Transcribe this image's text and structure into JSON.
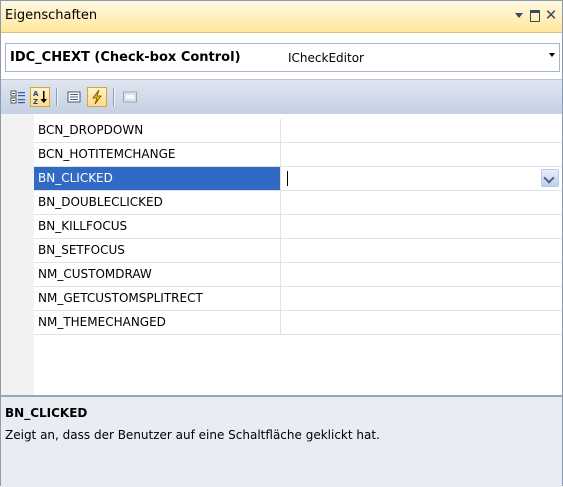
{
  "panel": {
    "title": "Eigenschaften",
    "buttons": {
      "dropdown": "window-position-icon",
      "float": "float-icon",
      "close": "close-icon"
    }
  },
  "selector": {
    "object_name": "IDC_CHEXT (Check-box Control)",
    "object_type": "ICheckEditor"
  },
  "toolbar": {
    "buttons": [
      {
        "name": "categorized-icon",
        "active": false
      },
      {
        "name": "alphabetical-icon",
        "active": true
      },
      {
        "name": "properties-icon",
        "active": false
      },
      {
        "name": "control-events-icon",
        "active": true
      },
      {
        "name": "property-pages-icon",
        "active": false
      }
    ]
  },
  "events": {
    "rows": [
      {
        "name": "BCN_DROPDOWN",
        "value": ""
      },
      {
        "name": "BCN_HOTITEMCHANGE",
        "value": ""
      },
      {
        "name": "BN_CLICKED",
        "value": "",
        "selected": true
      },
      {
        "name": "BN_DOUBLECLICKED",
        "value": ""
      },
      {
        "name": "BN_KILLFOCUS",
        "value": ""
      },
      {
        "name": "BN_SETFOCUS",
        "value": ""
      },
      {
        "name": "NM_CUSTOMDRAW",
        "value": ""
      },
      {
        "name": "NM_GETCUSTOMSPLITRECT",
        "value": ""
      },
      {
        "name": "NM_THEMECHANGED",
        "value": ""
      }
    ]
  },
  "description": {
    "title": "BN_CLICKED",
    "text": "Zeigt an, dass der Benutzer auf eine Schaltfläche geklickt hat."
  },
  "colors": {
    "title_bar": "#ffe79b",
    "selection": "#316ac5",
    "toolbar": "#c5d0e2",
    "description_bg": "#e9ecf2"
  }
}
